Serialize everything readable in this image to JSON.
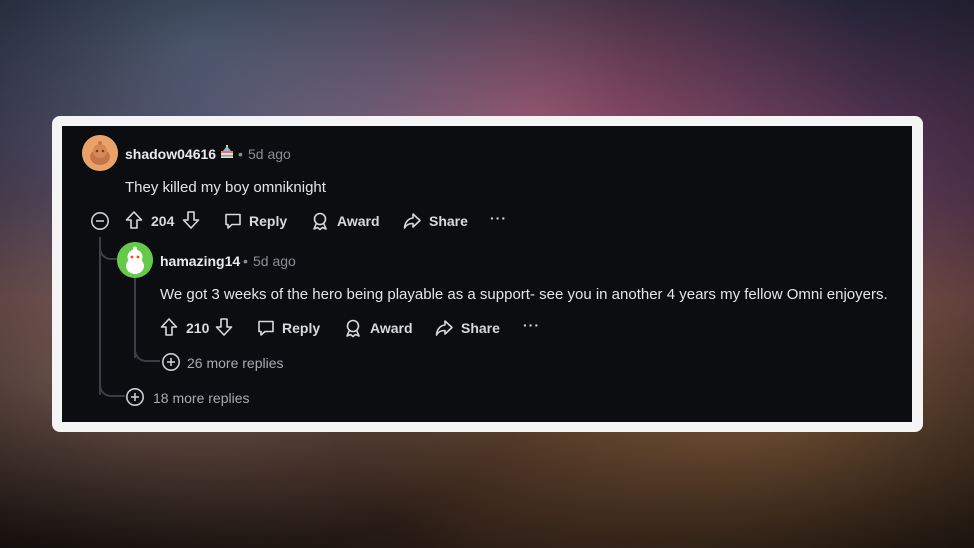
{
  "comment": {
    "username": "shadow04616",
    "flair_icon": "cake-icon",
    "time": "5d ago",
    "text": "They killed my boy omniknight",
    "votes": "204",
    "actions": {
      "reply": "Reply",
      "award": "Award",
      "share": "Share",
      "more": "···"
    },
    "more_replies": "18 more replies"
  },
  "reply": {
    "username": "hamazing14",
    "time": "5d ago",
    "text": "We got 3 weeks of the hero being playable as a support- see you in another 4 years my fellow Omni enjoyers.",
    "votes": "210",
    "actions": {
      "reply": "Reply",
      "award": "Award",
      "share": "Share",
      "more": "···"
    },
    "more_replies": "26 more replies"
  },
  "separator": "•",
  "colors": {
    "panel_bg": "#0b0d11",
    "avatar_1": "#e8a26a",
    "avatar_2": "#67c94a"
  }
}
